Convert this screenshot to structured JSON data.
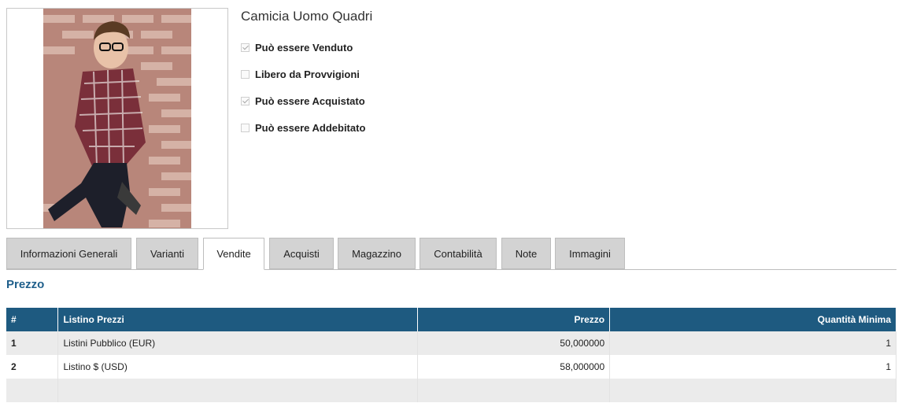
{
  "product": {
    "name": "Camicia Uomo Quadri",
    "options": [
      {
        "label": "Può essere Venduto",
        "checked": true
      },
      {
        "label": "Libero da Provvigioni",
        "checked": false
      },
      {
        "label": "Può essere Acquistato",
        "checked": true
      },
      {
        "label": "Può essere Addebitato",
        "checked": false
      }
    ]
  },
  "tabs": [
    {
      "label": "Informazioni Generali"
    },
    {
      "label": "Varianti"
    },
    {
      "label": "Vendite",
      "active": true
    },
    {
      "label": "Acquisti"
    },
    {
      "label": "Magazzino"
    },
    {
      "label": "Contabilità"
    },
    {
      "label": "Note"
    },
    {
      "label": "Immagini"
    }
  ],
  "pricing": {
    "section_title": "Prezzo",
    "headers": {
      "index": "#",
      "pricelist": "Listino Prezzi",
      "price": "Prezzo",
      "min_qty": "Quantità Minima"
    },
    "rows": [
      {
        "index": "1",
        "pricelist": "Listini Pubblico (EUR)",
        "price": "50,000000",
        "min_qty": "1"
      },
      {
        "index": "2",
        "pricelist": "Listino $ (USD)",
        "price": "58,000000",
        "min_qty": "1"
      }
    ]
  }
}
